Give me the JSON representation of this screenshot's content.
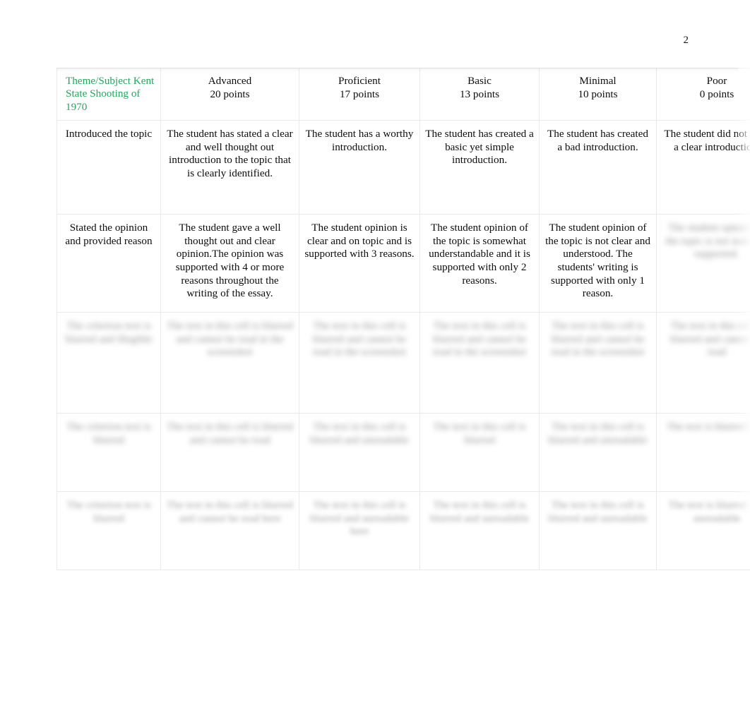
{
  "document": {
    "page_number": "2"
  },
  "rubric": {
    "header": {
      "subject_title": "Theme/Subject Kent State Shooting of 1970",
      "levels": [
        {
          "label": "Advanced",
          "points": "20 points"
        },
        {
          "label": "Proficient",
          "points": "17 points"
        },
        {
          "label": "Basic",
          "points": "13 points"
        },
        {
          "label": "Minimal",
          "points": "10 points"
        },
        {
          "label": "Poor",
          "points": "0 points"
        }
      ]
    },
    "rows": [
      {
        "criterion": "Introduced the topic",
        "legible": true,
        "cells": [
          "The student has stated a clear and well thought out introduction to the topic that is clearly identified.",
          "The student has a worthy introduction.",
          "The student has created a basic yet simple introduction.",
          "The student has created a bad introduction.",
          "The student did not state a clear introduction."
        ]
      },
      {
        "criterion": "Stated the opinion and provided reason",
        "legible": true,
        "cells": [
          "The student gave a well thought out and clear opinion.The opinion was supported with 4 or more reasons throughout the writing of the essay.",
          "The student opinion is clear and on topic and is supported with 3 reasons.",
          "The student opinion of the topic is somewhat understandable and it is supported with only 2 reasons.",
          "The student opinion of the topic is not clear and understood. The students' writing is supported with only 1 reason.",
          "The student opinion of the topic is not stated or supported."
        ]
      },
      {
        "criterion": "The criterion text is blurred and illegible",
        "legible": false,
        "cells": [
          "The text in this cell is blurred and cannot be read in the screenshot",
          "The text in this cell is blurred and cannot be read in the screenshot",
          "The text in this cell is blurred and cannot be read in the screenshot",
          "The text in this cell is blurred and cannot be read in the screenshot",
          "The text in this cell is blurred and cannot be read"
        ]
      },
      {
        "criterion": "The criterion text is blurred",
        "legible": false,
        "cells": [
          "The text in this cell is blurred and cannot be read",
          "The text in this cell is blurred and unreadable",
          "The text in this cell is blurred",
          "The text in this cell is blurred and unreadable",
          "The text is blurred here"
        ]
      },
      {
        "criterion": "The criterion text is blurred",
        "legible": false,
        "cells": [
          "The text in this cell is blurred and cannot be read here",
          "The text in this cell is blurred and unreadable here",
          "The text in this cell is blurred and unreadable",
          "The text in this cell is blurred and unreadable",
          "The text is blurred and unreadable"
        ]
      }
    ]
  }
}
